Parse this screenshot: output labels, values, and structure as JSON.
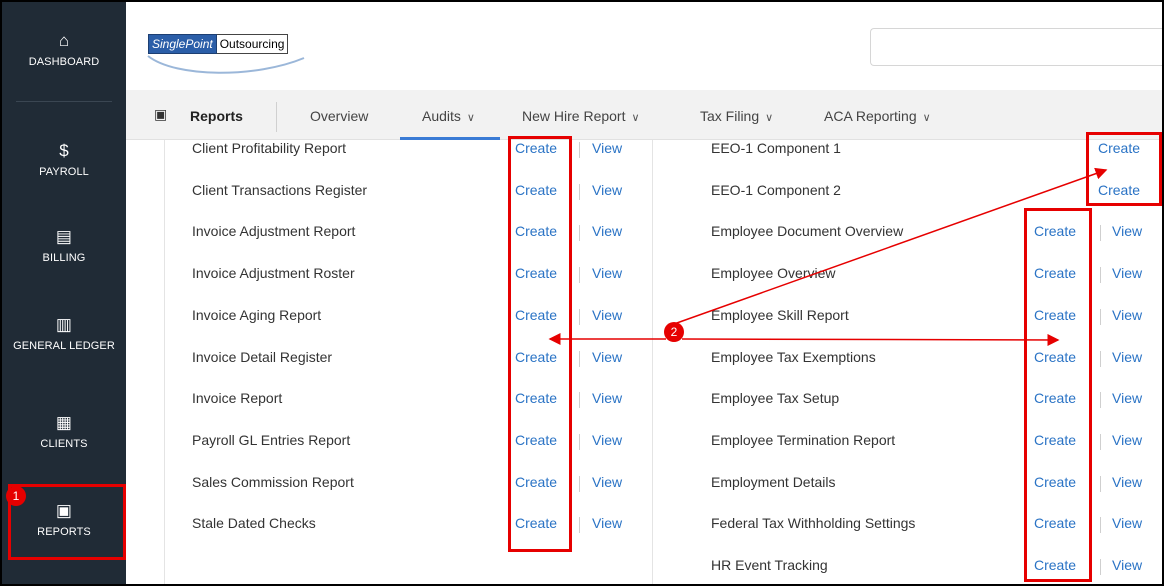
{
  "sidebar": {
    "items": [
      {
        "label": "DASHBOARD",
        "icon": "home-icon",
        "glyph": "⌂"
      },
      {
        "label": "PAYROLL",
        "icon": "dollar-circle-icon",
        "glyph": "$"
      },
      {
        "label": "BILLING",
        "icon": "invoice-icon",
        "glyph": "▤"
      },
      {
        "label": "GENERAL LEDGER",
        "icon": "ledger-books-icon",
        "glyph": "▥"
      },
      {
        "label": "CLIENTS",
        "icon": "building-icon",
        "glyph": "▦"
      },
      {
        "label": "REPORTS",
        "icon": "report-icon",
        "glyph": "▣"
      }
    ],
    "active": "REPORTS"
  },
  "header": {
    "logo_part1": "SinglePoint",
    "logo_part2": "Outsourcing",
    "search_placeholder": ""
  },
  "nav": {
    "title": "Reports",
    "tabs": [
      {
        "label": "Overview",
        "has_dropdown": false,
        "active": true
      },
      {
        "label": "Audits",
        "has_dropdown": true
      },
      {
        "label": "New Hire Report",
        "has_dropdown": true
      },
      {
        "label": "Tax Filing",
        "has_dropdown": true
      },
      {
        "label": "ACA Reporting",
        "has_dropdown": true
      }
    ],
    "chevron": "∨"
  },
  "links": {
    "create": "Create",
    "view": "View"
  },
  "left_reports": [
    "Client Profitability Report",
    "Client Transactions Register",
    "Invoice Adjustment Report",
    "Invoice Adjustment Roster",
    "Invoice Aging Report",
    "Invoice Detail Register",
    "Invoice Report",
    "Payroll GL Entries Report",
    "Sales Commission Report",
    "Stale Dated Checks"
  ],
  "right_reports": [
    {
      "label": "EEO-1 Component 1",
      "view": false
    },
    {
      "label": "EEO-1 Component 2",
      "view": false
    },
    {
      "label": "Employee Document Overview",
      "view": true
    },
    {
      "label": "Employee Overview",
      "view": true
    },
    {
      "label": "Employee Skill Report",
      "view": true
    },
    {
      "label": "Employee Tax Exemptions",
      "view": true
    },
    {
      "label": "Employee Tax Setup",
      "view": true
    },
    {
      "label": "Employee Termination Report",
      "view": true
    },
    {
      "label": "Employment Details",
      "view": true
    },
    {
      "label": "Federal Tax Withholding Settings",
      "view": true
    },
    {
      "label": "HR Event Tracking",
      "view": true
    }
  ],
  "annotations": {
    "step1": "1",
    "step2": "2",
    "color": "#e60000"
  },
  "colors": {
    "sidebar_bg": "#202b36",
    "link": "#2a73c5",
    "accent": "#3a7bd5"
  }
}
